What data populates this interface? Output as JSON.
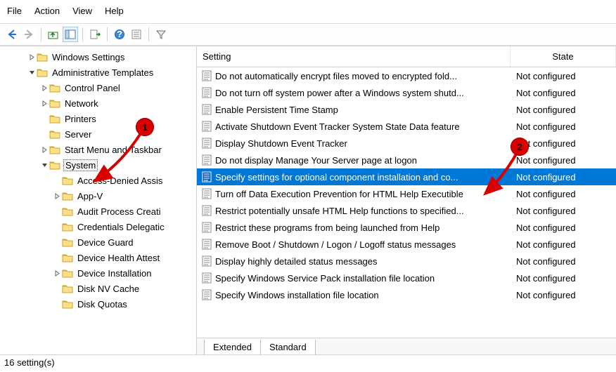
{
  "menubar": [
    "File",
    "Action",
    "View",
    "Help"
  ],
  "toolbar": {
    "back": "back-arrow",
    "forward": "forward-arrow",
    "up": "up",
    "showhide": "showhide",
    "export": "export",
    "help": "help",
    "props": "props",
    "filter": "filter"
  },
  "tree": [
    {
      "indent": 2,
      "expander": ">",
      "label": "Windows Settings",
      "selected": false
    },
    {
      "indent": 2,
      "expander": "v",
      "label": "Administrative Templates",
      "selected": false
    },
    {
      "indent": 3,
      "expander": ">",
      "label": "Control Panel",
      "selected": false
    },
    {
      "indent": 3,
      "expander": ">",
      "label": "Network",
      "selected": false
    },
    {
      "indent": 3,
      "expander": "",
      "label": "Printers",
      "selected": false
    },
    {
      "indent": 3,
      "expander": "",
      "label": "Server",
      "selected": false
    },
    {
      "indent": 3,
      "expander": ">",
      "label": "Start Menu and Taskbar",
      "selected": false
    },
    {
      "indent": 3,
      "expander": "v",
      "label": "System",
      "selected": true
    },
    {
      "indent": 4,
      "expander": "",
      "label": "Access-Denied Assis",
      "selected": false
    },
    {
      "indent": 4,
      "expander": ">",
      "label": "App-V",
      "selected": false
    },
    {
      "indent": 4,
      "expander": "",
      "label": "Audit Process Creati",
      "selected": false
    },
    {
      "indent": 4,
      "expander": "",
      "label": "Credentials Delegatic",
      "selected": false
    },
    {
      "indent": 4,
      "expander": "",
      "label": "Device Guard",
      "selected": false
    },
    {
      "indent": 4,
      "expander": "",
      "label": "Device Health Attest",
      "selected": false
    },
    {
      "indent": 4,
      "expander": ">",
      "label": "Device Installation",
      "selected": false
    },
    {
      "indent": 4,
      "expander": "",
      "label": "Disk NV Cache",
      "selected": false
    },
    {
      "indent": 4,
      "expander": "",
      "label": "Disk Quotas",
      "selected": false
    }
  ],
  "columns": {
    "setting": "Setting",
    "state": "State"
  },
  "rows": [
    {
      "label": "Do not automatically encrypt files moved to encrypted fold...",
      "state": "Not configured",
      "selected": false
    },
    {
      "label": "Do not turn off system power after a Windows system shutd...",
      "state": "Not configured",
      "selected": false
    },
    {
      "label": "Enable Persistent Time Stamp",
      "state": "Not configured",
      "selected": false
    },
    {
      "label": "Activate Shutdown Event Tracker System State Data feature",
      "state": "Not configured",
      "selected": false
    },
    {
      "label": "Display Shutdown Event Tracker",
      "state": "Not configured",
      "selected": false
    },
    {
      "label": "Do not display Manage Your Server page at logon",
      "state": "Not configured",
      "selected": false
    },
    {
      "label": "Specify settings for optional component installation and co...",
      "state": "Not configured",
      "selected": true
    },
    {
      "label": "Turn off Data Execution Prevention for HTML Help Executible",
      "state": "Not configured",
      "selected": false
    },
    {
      "label": "Restrict potentially unsafe HTML Help functions to specified...",
      "state": "Not configured",
      "selected": false
    },
    {
      "label": "Restrict these programs from being launched from Help",
      "state": "Not configured",
      "selected": false
    },
    {
      "label": "Remove Boot / Shutdown / Logon / Logoff status messages",
      "state": "Not configured",
      "selected": false
    },
    {
      "label": "Display highly detailed status messages",
      "state": "Not configured",
      "selected": false
    },
    {
      "label": "Specify Windows Service Pack installation file location",
      "state": "Not configured",
      "selected": false
    },
    {
      "label": "Specify Windows installation file location",
      "state": "Not configured",
      "selected": false
    }
  ],
  "tabs": [
    "Extended",
    "Standard"
  ],
  "statusbar": "16 setting(s)",
  "callouts": {
    "one": "1",
    "two": "2"
  }
}
